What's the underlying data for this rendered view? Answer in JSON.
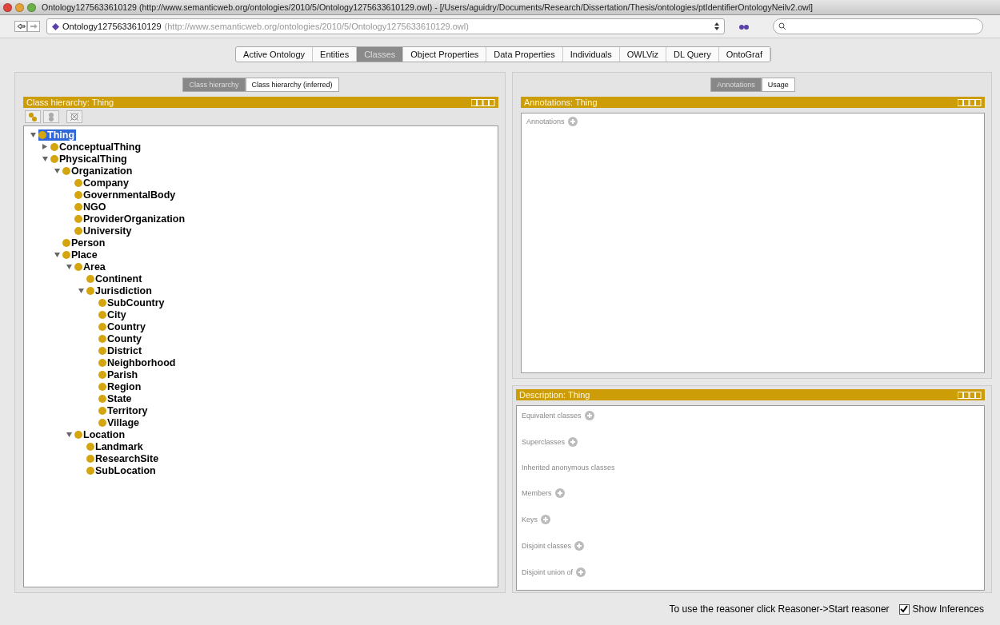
{
  "window": {
    "title": "Ontology1275633610129 (http://www.semanticweb.org/ontologies/2010/5/Ontology1275633610129.owl) - [/Users/aguidry/Documents/Research/Dissertation/Thesis/ontologies/ptIdentifierOntologyNeilv2.owl]"
  },
  "address": {
    "name": "Ontology1275633610129",
    "iri": "(http://www.semanticweb.org/ontologies/2010/5/Ontology1275633610129.owl)"
  },
  "tabs": [
    {
      "label": "Active Ontology",
      "selected": false
    },
    {
      "label": "Entities",
      "selected": false
    },
    {
      "label": "Classes",
      "selected": true
    },
    {
      "label": "Object Properties",
      "selected": false
    },
    {
      "label": "Data Properties",
      "selected": false
    },
    {
      "label": "Individuals",
      "selected": false
    },
    {
      "label": "OWLViz",
      "selected": false
    },
    {
      "label": "DL Query",
      "selected": false
    },
    {
      "label": "OntoGraf",
      "selected": false
    }
  ],
  "left": {
    "subtabs": [
      {
        "label": "Class hierarchy",
        "selected": true
      },
      {
        "label": "Class hierarchy (inferred)",
        "selected": false
      }
    ],
    "header": "Class hierarchy: Thing",
    "tree": [
      {
        "label": "Thing",
        "selected": true,
        "expanded": true,
        "children": [
          {
            "label": "ConceptualThing",
            "selected": false,
            "expanded": false
          },
          {
            "label": "PhysicalThing",
            "selected": false,
            "expanded": true,
            "children": [
              {
                "label": "Organization",
                "selected": false,
                "expanded": true,
                "children": [
                  {
                    "label": "Company",
                    "selected": false
                  },
                  {
                    "label": "GovernmentalBody",
                    "selected": false
                  },
                  {
                    "label": "NGO",
                    "selected": false
                  },
                  {
                    "label": "ProviderOrganization",
                    "selected": false
                  },
                  {
                    "label": "University",
                    "selected": false
                  }
                ]
              },
              {
                "label": "Person",
                "selected": false
              },
              {
                "label": "Place",
                "selected": false,
                "expanded": true,
                "children": [
                  {
                    "label": "Area",
                    "selected": false,
                    "expanded": true,
                    "children": [
                      {
                        "label": "Continent",
                        "selected": false
                      },
                      {
                        "label": "Jurisdiction",
                        "selected": false,
                        "expanded": true,
                        "children": [
                          {
                            "label": "SubCountry",
                            "selected": false
                          },
                          {
                            "label": "City",
                            "selected": false
                          },
                          {
                            "label": "Country",
                            "selected": false
                          },
                          {
                            "label": "County",
                            "selected": false
                          },
                          {
                            "label": "District",
                            "selected": false
                          },
                          {
                            "label": "Neighborhood",
                            "selected": false
                          },
                          {
                            "label": "Parish",
                            "selected": false
                          },
                          {
                            "label": "Region",
                            "selected": false
                          },
                          {
                            "label": "State",
                            "selected": false
                          },
                          {
                            "label": "Territory",
                            "selected": false
                          },
                          {
                            "label": "Village",
                            "selected": false
                          }
                        ]
                      }
                    ]
                  },
                  {
                    "label": "Location",
                    "selected": false,
                    "expanded": true,
                    "children": [
                      {
                        "label": "Landmark",
                        "selected": false
                      },
                      {
                        "label": "ResearchSite",
                        "selected": false
                      },
                      {
                        "label": "SubLocation",
                        "selected": false
                      }
                    ]
                  }
                ]
              }
            ]
          }
        ]
      }
    ]
  },
  "right": {
    "subtabs": [
      {
        "label": "Annotations",
        "selected": true
      },
      {
        "label": "Usage",
        "selected": false
      }
    ],
    "header": "Annotations: Thing",
    "annotations": [
      {
        "label": "Annotations",
        "addable": true
      }
    ],
    "description_header": "Description: Thing",
    "description": [
      {
        "label": "Equivalent classes",
        "addable": true
      },
      {
        "label": "Superclasses",
        "addable": true
      },
      {
        "label": "Inherited anonymous classes",
        "addable": false
      },
      {
        "label": "Members",
        "addable": true
      },
      {
        "label": "Keys",
        "addable": true
      },
      {
        "label": "Disjoint classes",
        "addable": true
      },
      {
        "label": "Disjoint union of",
        "addable": true
      }
    ]
  },
  "status_bar": {
    "message": "To use the reasoner click Reasoner->Start reasoner",
    "show_inferences": {
      "label": "Show Inferences",
      "checked": true
    }
  }
}
